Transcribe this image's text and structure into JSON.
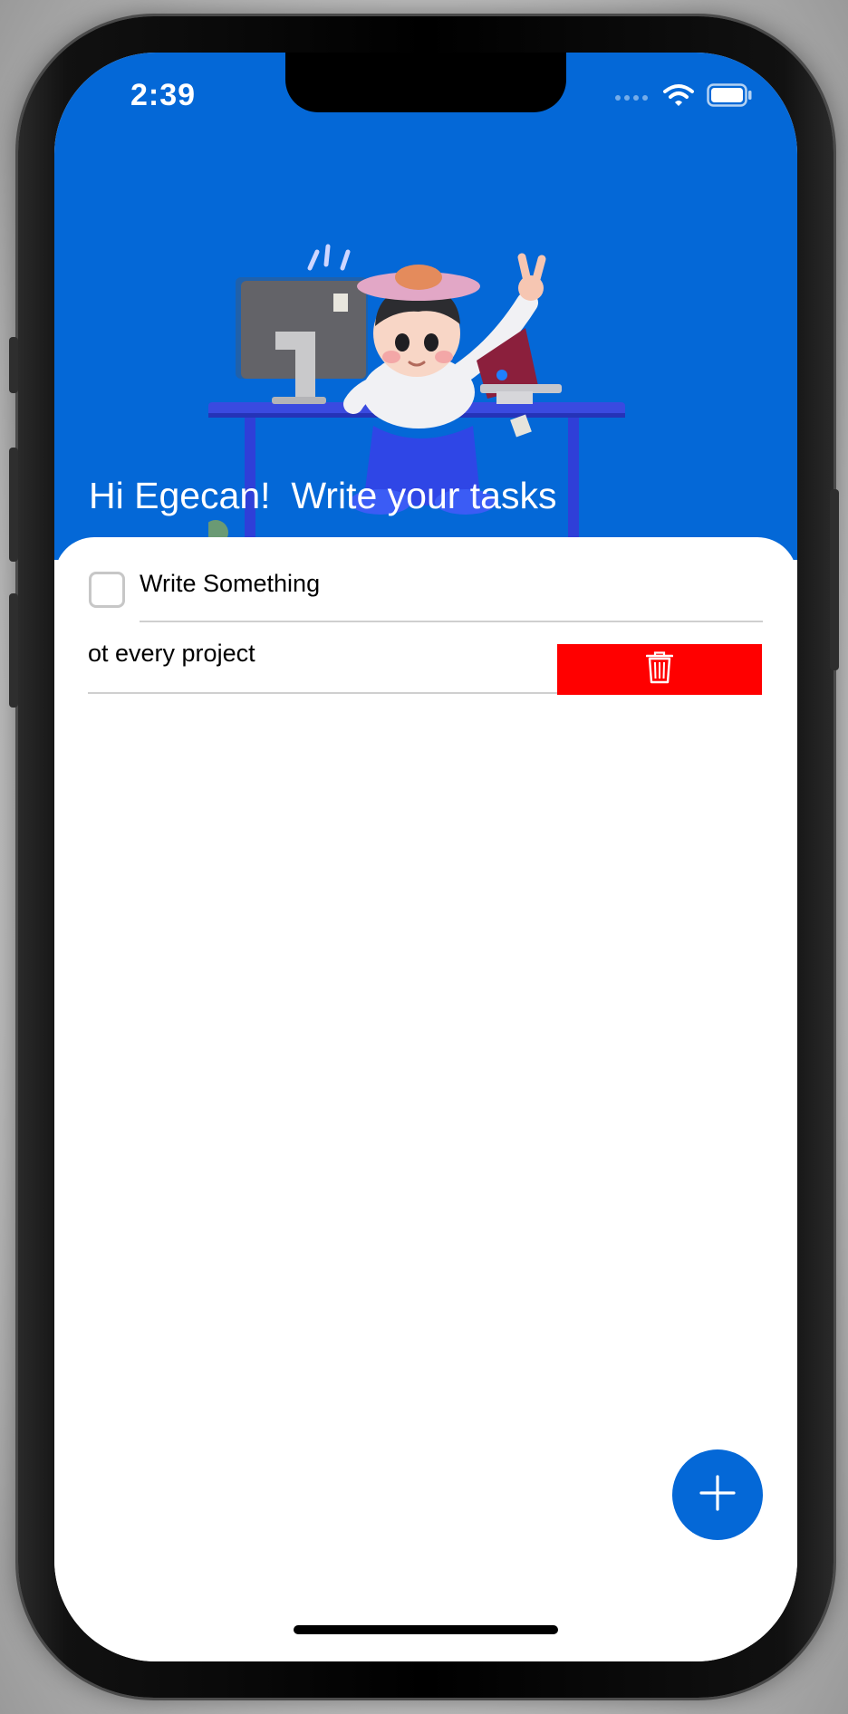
{
  "status_bar": {
    "time": "2:39",
    "icons": [
      "cellular-dots-icon",
      "wifi-icon",
      "battery-icon"
    ]
  },
  "header": {
    "greeting": "Hi Egecan!  Write your tasks",
    "illustration": "person-at-desk-illustration",
    "background_color": "#0468d7"
  },
  "tasks": [
    {
      "text": "Write Something",
      "checked": false
    },
    {
      "text": "ot every project",
      "swiped": true
    }
  ],
  "actions": {
    "delete_icon": "trash-icon",
    "delete_color": "#ff0000",
    "add_icon": "plus-icon"
  }
}
